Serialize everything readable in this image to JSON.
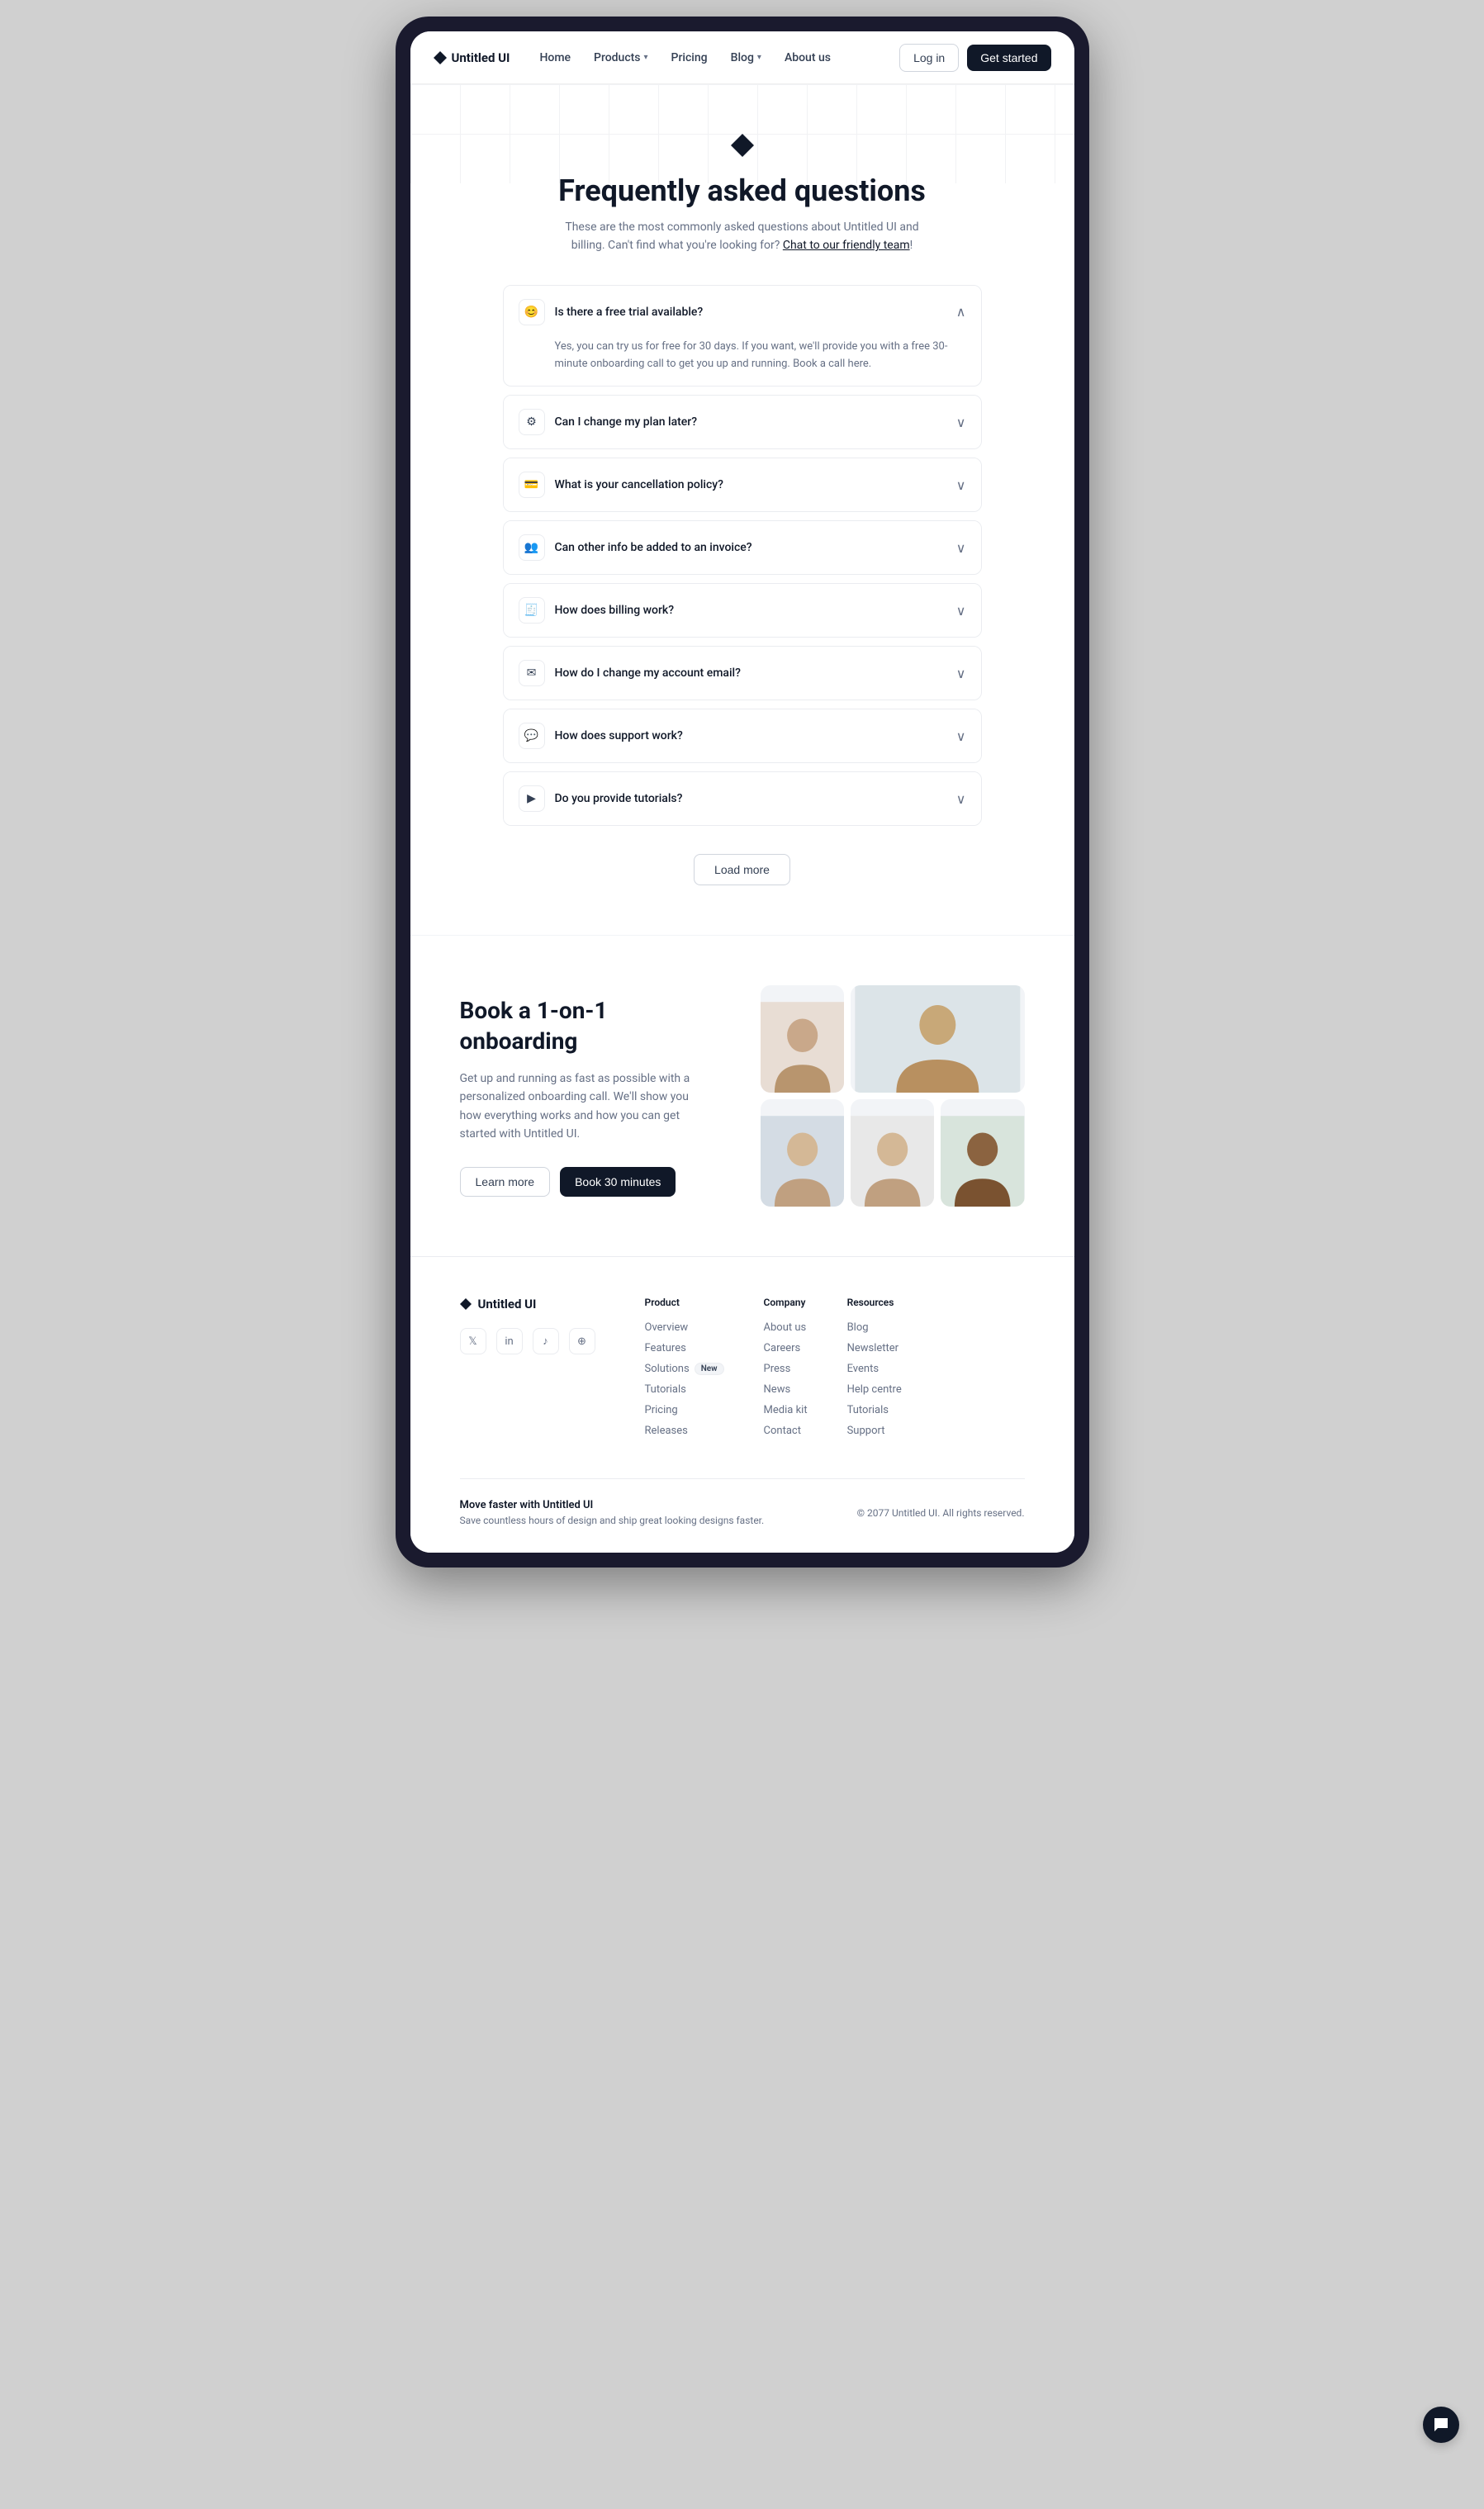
{
  "navbar": {
    "logo_text": "Untitled UI",
    "links": [
      {
        "label": "Home",
        "has_dropdown": false
      },
      {
        "label": "Products",
        "has_dropdown": true
      },
      {
        "label": "Pricing",
        "has_dropdown": false
      },
      {
        "label": "Blog",
        "has_dropdown": true
      },
      {
        "label": "About us",
        "has_dropdown": false
      }
    ],
    "login_label": "Log in",
    "getstarted_label": "Get started"
  },
  "faq": {
    "diamond_icon": "♦",
    "title": "Frequently asked questions",
    "subtitle": "These are the most commonly asked questions about Untitled UI and billing. Can't find what you're looking for?",
    "subtitle_link": "Chat to our friendly team",
    "subtitle_end": "!",
    "items": [
      {
        "icon": "😊",
        "question": "Is there a free trial available?",
        "answer": "Yes, you can try us for free for 30 days. If you want, we'll provide you with a free 30-minute onboarding call to get you up and running. Book a call here.",
        "open": true
      },
      {
        "icon": "⚙",
        "question": "Can I change my plan later?",
        "answer": "",
        "open": false
      },
      {
        "icon": "💳",
        "question": "What is your cancellation policy?",
        "answer": "",
        "open": false
      },
      {
        "icon": "👥",
        "question": "Can other info be added to an invoice?",
        "answer": "",
        "open": false
      },
      {
        "icon": "🧾",
        "question": "How does billing work?",
        "answer": "",
        "open": false
      },
      {
        "icon": "✉",
        "question": "How do I change my account email?",
        "answer": "",
        "open": false
      },
      {
        "icon": "💬",
        "question": "How does support work?",
        "answer": "",
        "open": false
      },
      {
        "icon": "▶",
        "question": "Do you provide tutorials?",
        "answer": "",
        "open": false
      }
    ],
    "load_more_label": "Load more"
  },
  "onboarding": {
    "title": "Book a 1-on-1 onboarding",
    "description": "Get up and running as fast as possible with a personalized onboarding call. We'll show you how everything works and how you can get started with Untitled UI.",
    "learn_more_label": "Learn more",
    "book_label": "Book 30 minutes",
    "people": [
      {
        "id": "p1",
        "bg": "#e8ddd4"
      },
      {
        "id": "p2",
        "bg": "#dce4e8"
      },
      {
        "id": "p3",
        "bg": "#d4dce4"
      },
      {
        "id": "p4",
        "bg": "#e4dcd4"
      },
      {
        "id": "p5",
        "bg": "#d8e4dc"
      }
    ]
  },
  "footer": {
    "logo_text": "Untitled UI",
    "social_icons": [
      "twitter",
      "linkedin",
      "tiktok",
      "dribbble"
    ],
    "columns": [
      {
        "heading": "Product",
        "links": [
          {
            "label": "Overview",
            "badge": null
          },
          {
            "label": "Features",
            "badge": null
          },
          {
            "label": "Solutions",
            "badge": "New"
          },
          {
            "label": "Tutorials",
            "badge": null
          },
          {
            "label": "Pricing",
            "badge": null
          },
          {
            "label": "Releases",
            "badge": null
          }
        ]
      },
      {
        "heading": "Company",
        "links": [
          {
            "label": "About us",
            "badge": null
          },
          {
            "label": "Careers",
            "badge": null
          },
          {
            "label": "Press",
            "badge": null
          },
          {
            "label": "News",
            "badge": null
          },
          {
            "label": "Media kit",
            "badge": null
          },
          {
            "label": "Contact",
            "badge": null
          }
        ]
      },
      {
        "heading": "Resources",
        "links": [
          {
            "label": "Blog",
            "badge": null
          },
          {
            "label": "Newsletter",
            "badge": null
          },
          {
            "label": "Events",
            "badge": null
          },
          {
            "label": "Help centre",
            "badge": null
          },
          {
            "label": "Tutorials",
            "badge": null
          },
          {
            "label": "Support",
            "badge": null
          }
        ]
      }
    ],
    "tagline_title": "Move faster with Untitled UI",
    "tagline_desc": "Save countless hours of design and ship great looking designs faster.",
    "copyright": "© 2077 Untitled UI. All rights reserved."
  }
}
